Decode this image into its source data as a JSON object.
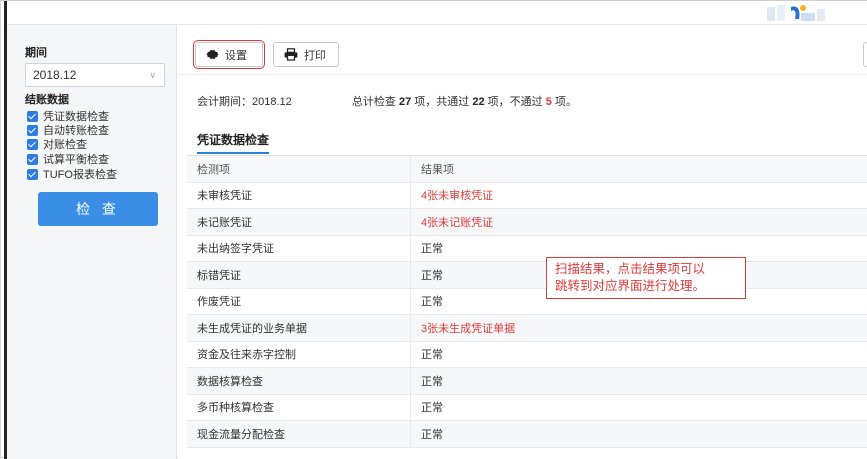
{
  "sidebar": {
    "period_label": "期间",
    "period_value": "2018.12",
    "closing_label": "结账数据",
    "checks": [
      {
        "label": "凭证数据检查",
        "checked": true
      },
      {
        "label": "自动转账检查",
        "checked": true
      },
      {
        "label": "对账检查",
        "checked": true
      },
      {
        "label": "试算平衡检查",
        "checked": true
      },
      {
        "label": "TUFO报表检查",
        "checked": true
      }
    ],
    "check_button": "检 查"
  },
  "toolbar": {
    "settings_label": "设置",
    "print_label": "打印"
  },
  "summary": {
    "period_text": "会计期间：2018.12",
    "total_prefix": "总计检查",
    "total": "27",
    "total_suffix": "项，共通过",
    "passed": "22",
    "passed_suffix": "项，不通过",
    "failed": "5",
    "failed_suffix": "项。"
  },
  "section_title": "凭证数据检查",
  "table": {
    "headers": [
      "检测项",
      "结果项"
    ],
    "rows": [
      {
        "item": "未审核凭证",
        "result": "4张未审核凭证",
        "fail": true
      },
      {
        "item": "未记账凭证",
        "result": "4张未记账凭证",
        "fail": true
      },
      {
        "item": "未出纳签字凭证",
        "result": "正常",
        "fail": false
      },
      {
        "item": "标错凭证",
        "result": "正常",
        "fail": false
      },
      {
        "item": "作废凭证",
        "result": "正常",
        "fail": false
      },
      {
        "item": "未生成凭证的业务单据",
        "result": "3张未生成凭证单据",
        "fail": true
      },
      {
        "item": "资金及往来赤字控制",
        "result": "正常",
        "fail": false
      },
      {
        "item": "数据核算检查",
        "result": "正常",
        "fail": false
      },
      {
        "item": "多币种核算检查",
        "result": "正常",
        "fail": false
      },
      {
        "item": "现金流量分配检查",
        "result": "正常",
        "fail": false
      }
    ]
  },
  "callout": {
    "line1": "扫描结果，点击结果项可以",
    "line2": "跳转到对应界面进行处理。"
  },
  "colors": {
    "accent": "#3a8ee6",
    "fail": "#e03a3a"
  }
}
